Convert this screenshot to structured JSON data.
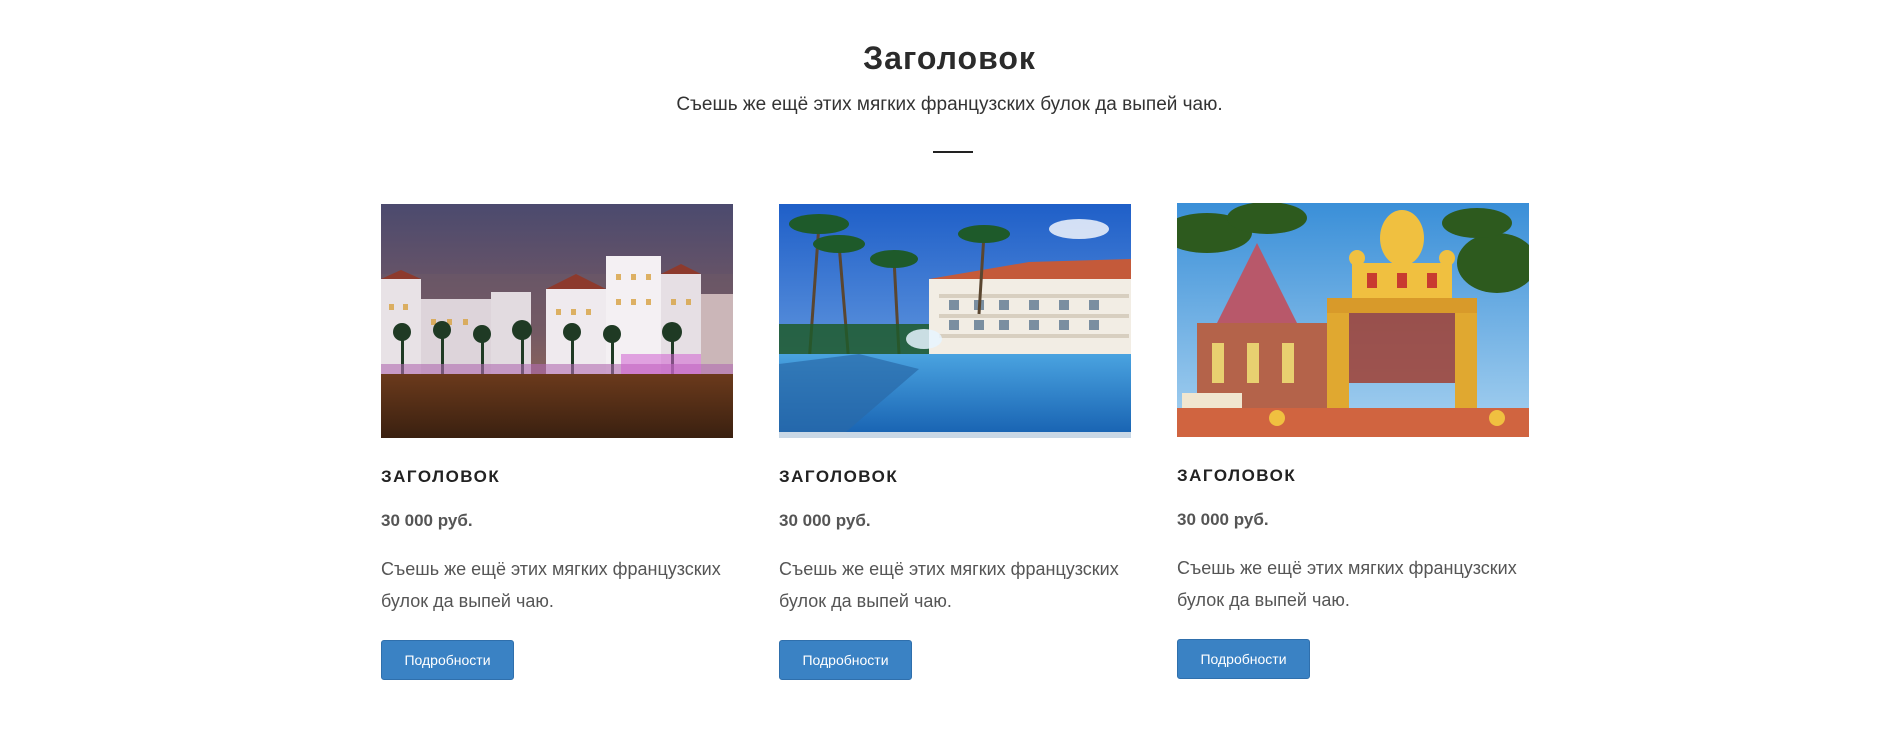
{
  "header": {
    "title": "Заголовок",
    "subtitle": "Съешь же ещё этих мягких французских булок да выпей чаю."
  },
  "cards": [
    {
      "image": "night-hotel-photo",
      "title": "ЗАГОЛОВОК",
      "price": "30 000 руб.",
      "text": "Съешь же ещё этих мягких французских булок да выпей чаю.",
      "button": "Подробности"
    },
    {
      "image": "pool-resort-photo",
      "title": "ЗАГОЛОВОК",
      "price": "30 000 руб.",
      "text": "Съешь же ещё этих мягких французских булок да выпей чаю.",
      "button": "Подробности"
    },
    {
      "image": "temple-gate-photo",
      "title": "ЗАГОЛОВОК",
      "price": "30 000 руб.",
      "text": "Съешь же ещё этих мягких французских булок да выпей чаю.",
      "button": "Подробности"
    }
  ],
  "colors": {
    "button_bg": "#3a82c4",
    "heading": "#2b2b2b",
    "body_text": "#555555"
  }
}
